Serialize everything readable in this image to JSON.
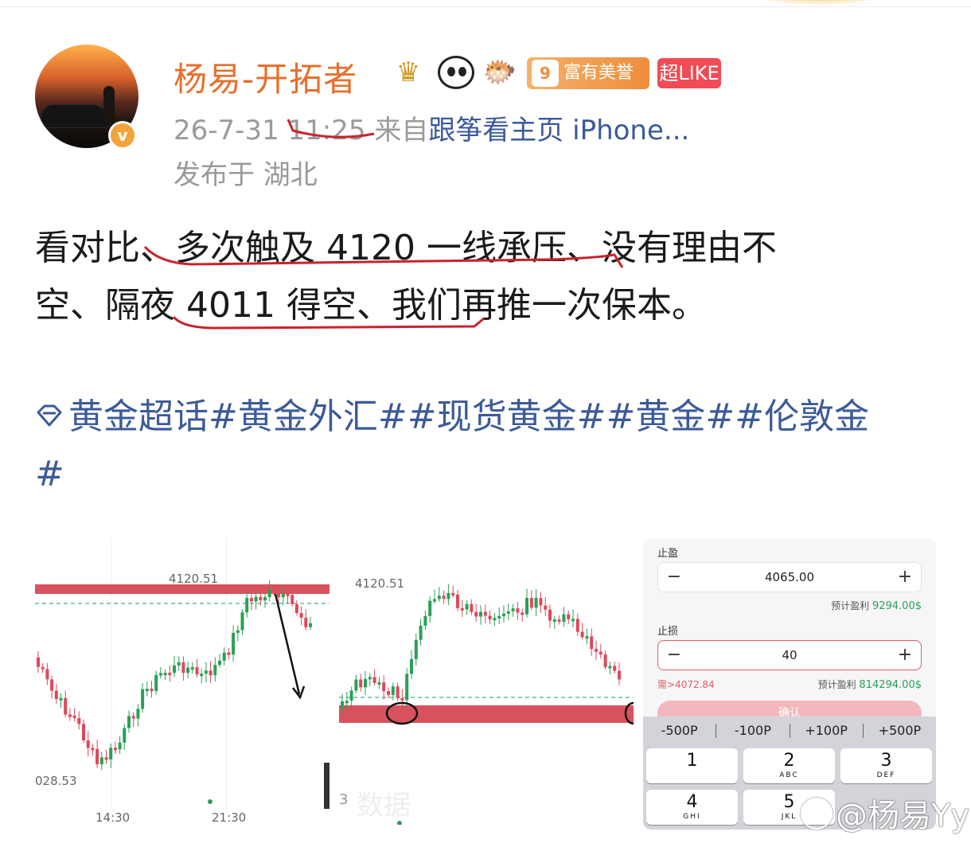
{
  "post": {
    "username": "杨易-开拓者",
    "badges": {
      "honor_level": "9",
      "honor_label": "富有美誉",
      "super_like": "超LIKE"
    },
    "meta": {
      "time": "26-7-31 11:25",
      "from_prefix": "来自",
      "source": "跟筝看主页 iPhone...",
      "location": "发布于 湖北"
    },
    "text_line1": "看对比、多次触及 4120 一线承压、没有理由不",
    "text_line2": "空、隔夜 4011 得空、我们再推一次保本。",
    "hashtags_line1": "黄金超话#黄金外汇##现货黄金##黄金##伦敦金",
    "hashtags_line2": "#"
  },
  "images": {
    "chart1": {
      "level_label": "4120.51",
      "low_label": "028.53",
      "x_ticks": [
        "14:30",
        "21:30"
      ]
    },
    "chart2": {
      "level_label": "4120.51",
      "low_label": "3",
      "faded_text": "数据"
    },
    "order_panel": {
      "take_profit_label": "止盈",
      "take_profit_value": "4065.00",
      "est_profit1_label": "预计盈利",
      "est_profit1_value": "9294.00$",
      "stop_loss_label": "止损",
      "stop_loss_value": "40",
      "requirement": "需>4072.84",
      "est_profit2_label": "预计盈利",
      "est_profit2_value": "814294.00$",
      "confirm_label": "确认",
      "quick_buttons": [
        "-500P",
        "-100P",
        "+100P",
        "+500P"
      ],
      "keys": [
        {
          "num": "1",
          "sub": ""
        },
        {
          "num": "2",
          "sub": "ABC"
        },
        {
          "num": "3",
          "sub": "DEF"
        },
        {
          "num": "4",
          "sub": "GHI"
        },
        {
          "num": "5",
          "sub": "JKL"
        }
      ]
    }
  },
  "watermark": "@杨易Yy",
  "colors": {
    "username": "#e76f2c",
    "link": "#3b5a99",
    "resistance_band": "#d8525e",
    "candle_up": "#2aa055",
    "candle_down": "#e0485a"
  }
}
